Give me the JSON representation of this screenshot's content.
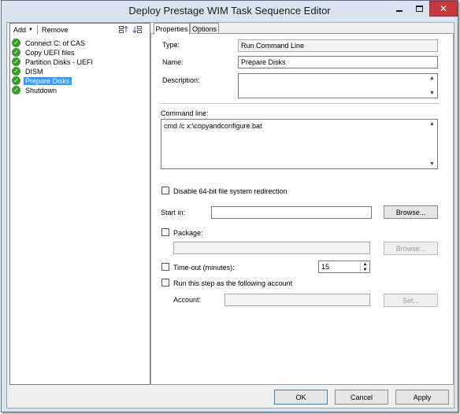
{
  "window": {
    "title": "Deploy Prestage WIM Task Sequence Editor"
  },
  "toolbar": {
    "add_label": "Add",
    "remove_label": "Remove"
  },
  "steps": [
    {
      "label": "Connect C: of CAS"
    },
    {
      "label": "Copy UEFI files"
    },
    {
      "label": "Partition Disks - UEFI"
    },
    {
      "label": "DISM"
    },
    {
      "label": "Prepare Disks",
      "selected": true
    },
    {
      "label": "Shutdown"
    }
  ],
  "tabs": [
    {
      "label": "Properties"
    },
    {
      "label": "Options"
    }
  ],
  "properties": {
    "type_label": "Type:",
    "type_value": "Run Command Line",
    "name_label": "Name:",
    "name_value": "Prepare Disks",
    "description_label": "Description:",
    "description_value": "",
    "command_line_label": "Command line:",
    "command_line_value": "cmd /c x:\\copyandconfigure.bat",
    "disable_redirection_label": "Disable 64-bit file system redirection",
    "start_in_label": "Start in:",
    "start_in_value": "",
    "browse_label": "Browse...",
    "package_label": "Package:",
    "package_value": "",
    "package_browse_label": "Browse...",
    "timeout_label": "Time-out (minutes):",
    "timeout_value": "15",
    "run_as_label": "Run this step as the following account",
    "account_label": "Account:",
    "account_value": "",
    "set_label": "Set..."
  },
  "buttons": {
    "ok": "OK",
    "cancel": "Cancel",
    "apply": "Apply"
  },
  "colors": {
    "selection": "#3399ff",
    "check_green": "#3a9a2a",
    "close_red": "#c7393d",
    "frame": "#d9e4f1"
  }
}
